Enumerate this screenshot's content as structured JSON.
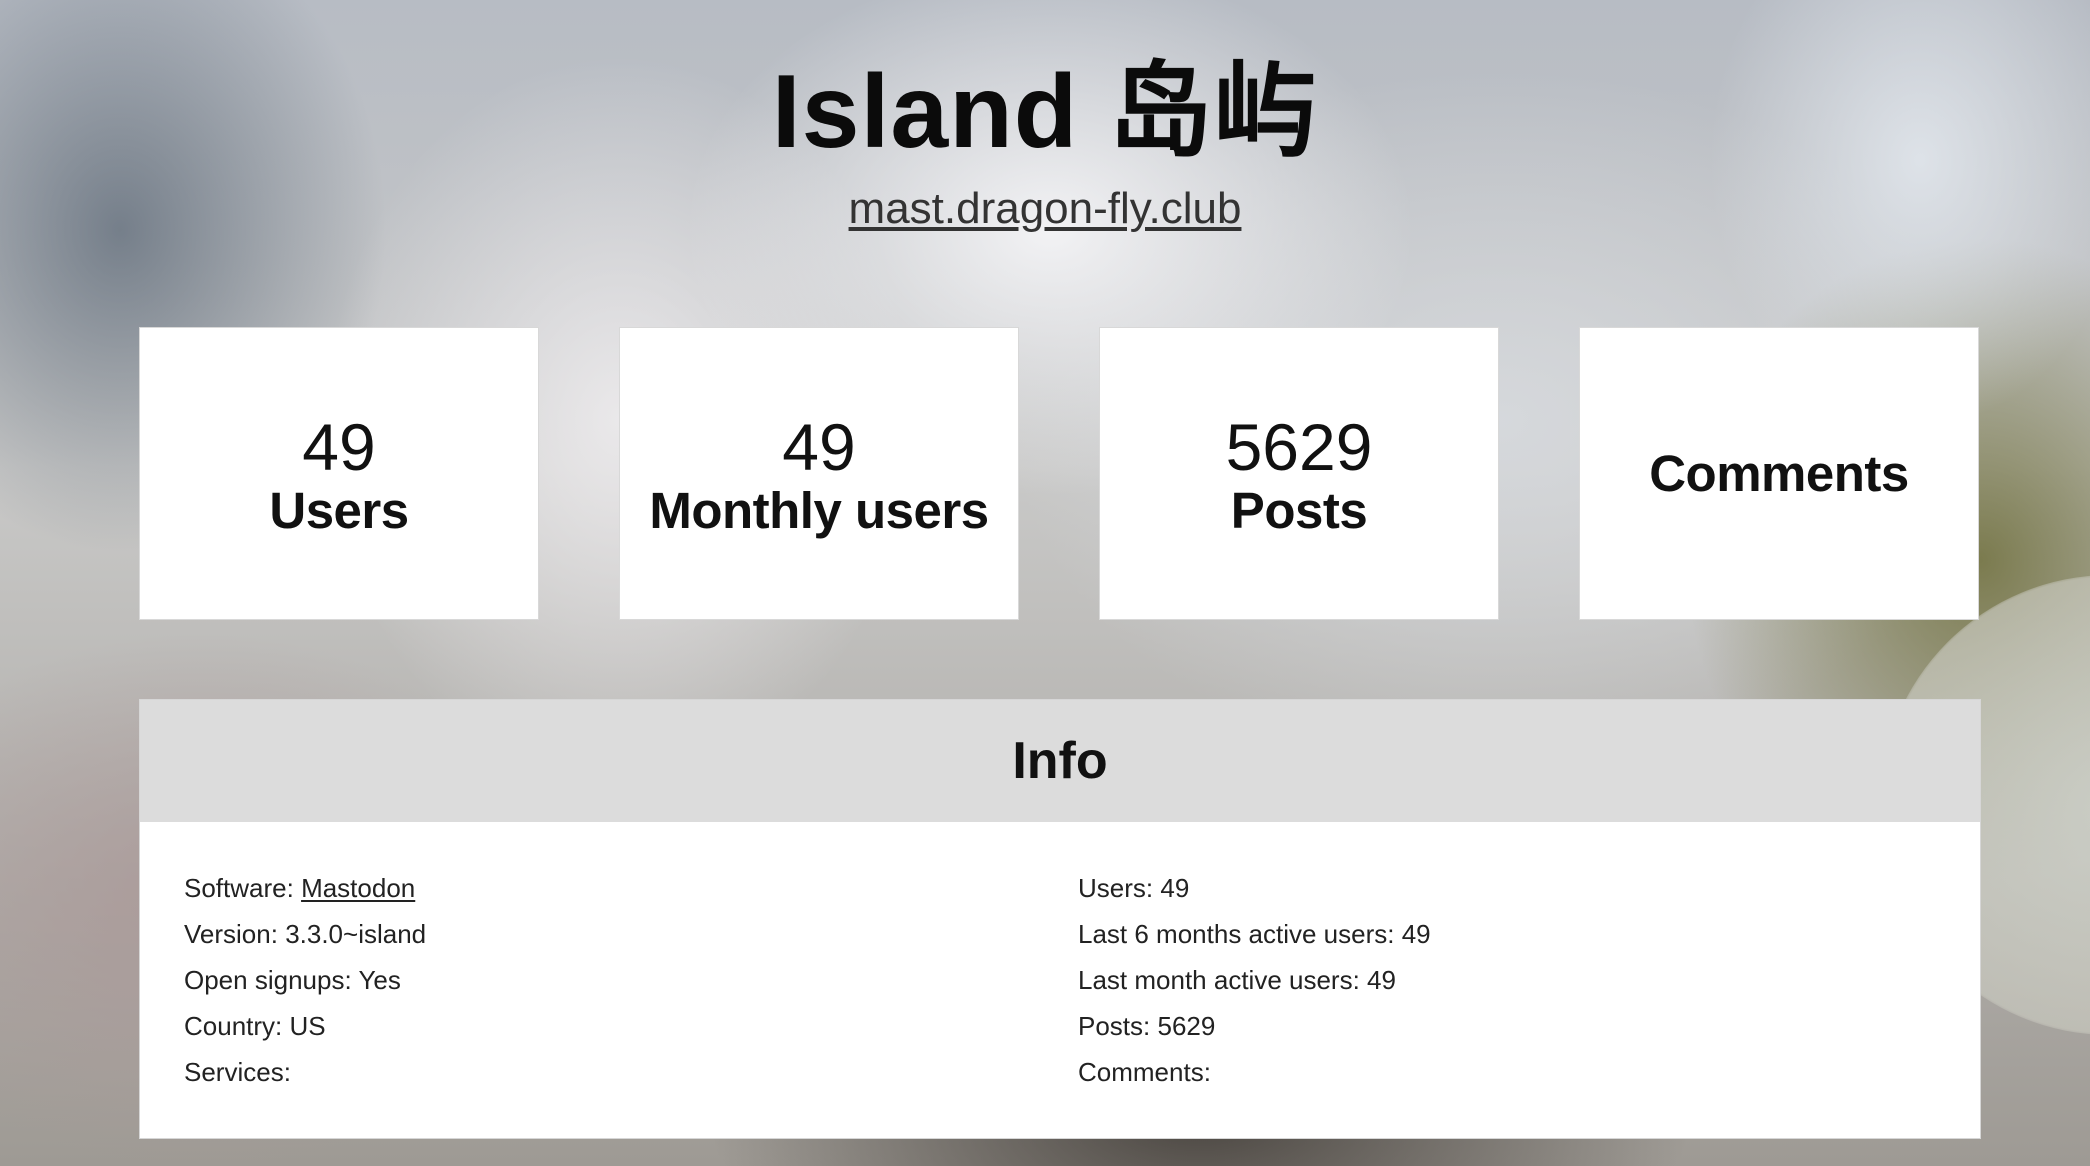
{
  "header": {
    "title": "Island 岛屿",
    "domain": "mast.dragon-fly.club"
  },
  "stats": [
    {
      "value": "49",
      "label": "Users"
    },
    {
      "value": "49",
      "label": "Monthly users"
    },
    {
      "value": "5629",
      "label": "Posts"
    },
    {
      "value": "",
      "label": "Comments"
    }
  ],
  "info": {
    "title": "Info",
    "software": {
      "label": "Software:",
      "value": "Mastodon"
    },
    "version": {
      "label": "Version:",
      "value": "3.3.0~island"
    },
    "open_signups": {
      "label": "Open signups:",
      "value": "Yes"
    },
    "country": {
      "label": "Country:",
      "value": "US"
    },
    "services": {
      "label": "Services:",
      "value": ""
    },
    "users": {
      "label": "Users:",
      "value": "49"
    },
    "active_6_months": {
      "label": "Last 6 months active users:",
      "value": "49"
    },
    "active_month": {
      "label": "Last month active users:",
      "value": "49"
    },
    "posts": {
      "label": "Posts:",
      "value": "5629"
    },
    "comments": {
      "label": "Comments:",
      "value": ""
    }
  }
}
